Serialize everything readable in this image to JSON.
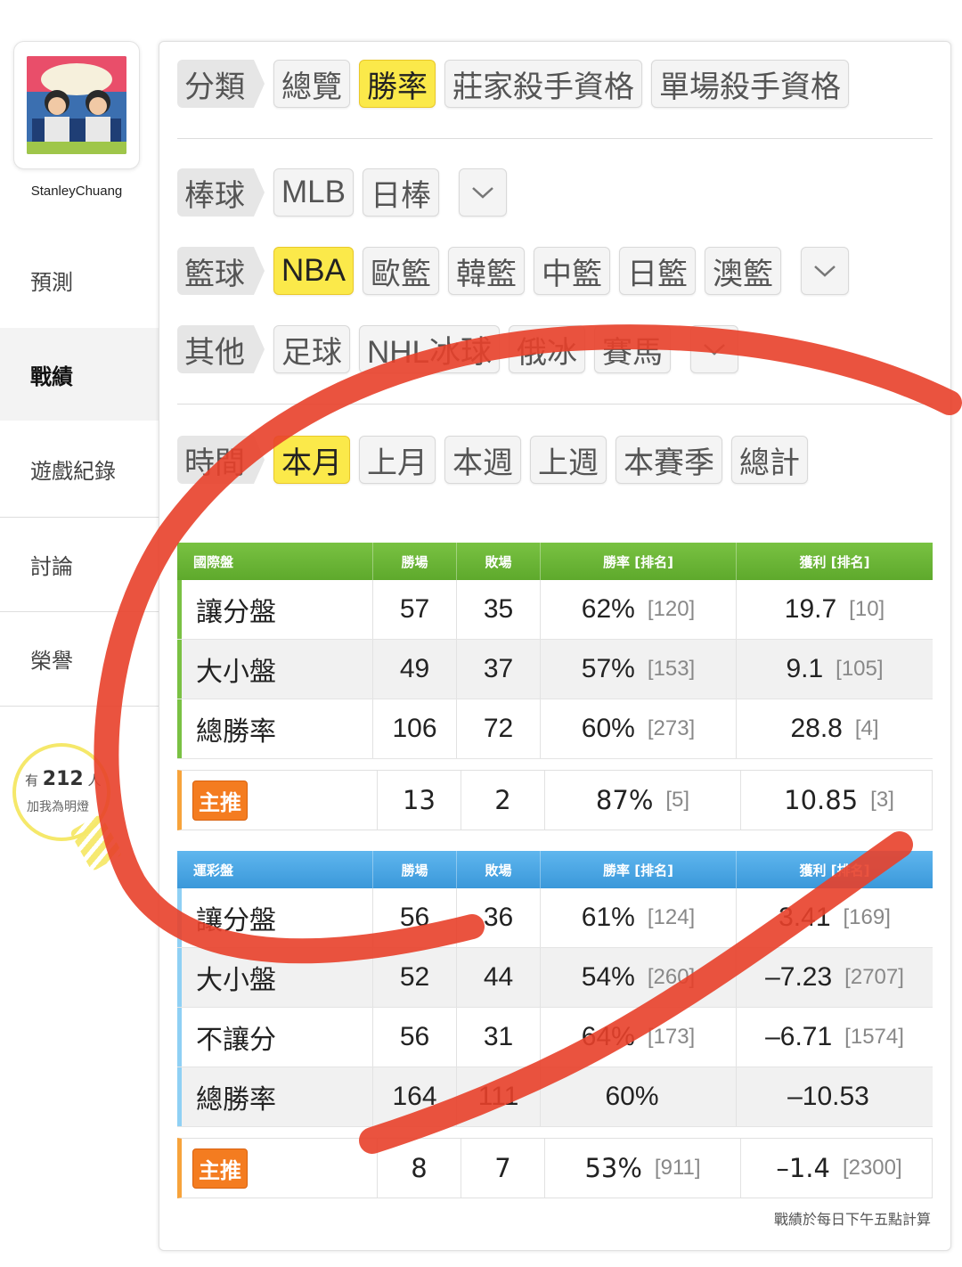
{
  "user": {
    "name": "StanleyChuang"
  },
  "nav": {
    "items": [
      {
        "label": "預測",
        "active": false
      },
      {
        "label": "戰績",
        "active": true
      },
      {
        "label": "遊戲紀錄",
        "active": false
      },
      {
        "label": "討論",
        "active": false
      },
      {
        "label": "榮譽",
        "active": false
      }
    ]
  },
  "fans": {
    "prefix": "有",
    "count": "212",
    "suffix": "人",
    "line2": "加我為明燈"
  },
  "filters": {
    "category": {
      "header": "分類",
      "buttons": [
        "總覽",
        "勝率",
        "莊家殺手資格",
        "單場殺手資格"
      ],
      "active": "勝率"
    },
    "baseball": {
      "header": "棒球",
      "buttons": [
        "MLB",
        "日棒"
      ]
    },
    "basketball": {
      "header": "籃球",
      "buttons": [
        "NBA",
        "歐籃",
        "韓籃",
        "中籃",
        "日籃",
        "澳籃"
      ],
      "active": "NBA"
    },
    "other": {
      "header": "其他",
      "buttons": [
        "足球",
        "NHL冰球",
        "俄冰",
        "賽馬"
      ]
    },
    "time": {
      "header": "時間",
      "buttons": [
        "本月",
        "上月",
        "本週",
        "上週",
        "本賽季",
        "總計"
      ],
      "active": "本月"
    }
  },
  "tables": {
    "international": {
      "title": "國際盤",
      "columns": [
        "勝場",
        "敗場",
        "勝率 [排名]",
        "獲利 [排名]"
      ],
      "rows": [
        {
          "name": "讓分盤",
          "win": "57",
          "loss": "35",
          "rate": "62%",
          "rate_rank": "[120]",
          "profit": "19.7",
          "profit_rank": "[10]"
        },
        {
          "name": "大小盤",
          "win": "49",
          "loss": "37",
          "rate": "57%",
          "rate_rank": "[153]",
          "profit": "9.1",
          "profit_rank": "[105]"
        },
        {
          "name": "總勝率",
          "win": "106",
          "loss": "72",
          "rate": "60%",
          "rate_rank": "[273]",
          "profit": "28.8",
          "profit_rank": "[4]"
        }
      ],
      "pick": {
        "label": "主推",
        "win": "13",
        "loss": "2",
        "rate": "87%",
        "rate_rank": "[5]",
        "profit": "10.85",
        "profit_rank": "[3]"
      }
    },
    "sportslottery": {
      "title": "運彩盤",
      "columns": [
        "勝場",
        "敗場",
        "勝率 [排名]",
        "獲利 [排名]"
      ],
      "rows": [
        {
          "name": "讓分盤",
          "win": "56",
          "loss": "36",
          "rate": "61%",
          "rate_rank": "[124]",
          "profit": "3.41",
          "profit_rank": "[169]"
        },
        {
          "name": "大小盤",
          "win": "52",
          "loss": "44",
          "rate": "54%",
          "rate_rank": "[260]",
          "profit": "–7.23",
          "profit_rank": "[2707]"
        },
        {
          "name": "不讓分",
          "win": "56",
          "loss": "31",
          "rate": "64%",
          "rate_rank": "[173]",
          "profit": "–6.71",
          "profit_rank": "[1574]"
        },
        {
          "name": "總勝率",
          "win": "164",
          "loss": "111",
          "rate": "60%",
          "rate_rank": "",
          "profit": "–10.53",
          "profit_rank": ""
        }
      ],
      "pick": {
        "label": "主推",
        "win": "8",
        "loss": "7",
        "rate": "53%",
        "rate_rank": "[911]",
        "profit": "–1.4",
        "profit_rank": "[2300]"
      }
    }
  },
  "footnote": "戰績於每日下午五點計算",
  "colors": {
    "active_button": "#fbe94a",
    "table1_header": "#6ab735",
    "table2_header": "#47a3e3",
    "pick_badge": "#f47c20",
    "annotation_stroke": "#e8402a"
  }
}
